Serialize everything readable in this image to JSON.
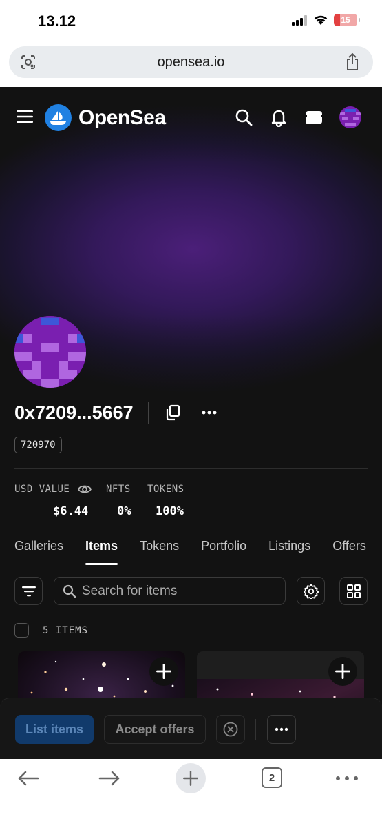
{
  "status_bar": {
    "time": "13.12",
    "battery": "15"
  },
  "browser": {
    "url": "opensea.io",
    "tab_count": "2"
  },
  "header": {
    "brand": "OpenSea"
  },
  "profile": {
    "address": "0x7209...5667",
    "id": "720970",
    "stats": {
      "labels": [
        "USD VALUE",
        "NFTS",
        "TOKENS"
      ],
      "values": [
        "$6.44",
        "0%",
        "100%"
      ]
    }
  },
  "tabs": [
    "Galleries",
    "Items",
    "Tokens",
    "Portfolio",
    "Listings",
    "Offers"
  ],
  "active_tab": "Items",
  "search": {
    "placeholder": "Search for items"
  },
  "items": {
    "count_label": "5 ITEMS"
  },
  "actions": {
    "list_label": "List items",
    "accept_label": "Accept offers"
  },
  "colors": {
    "accent": "#2081e2",
    "purple": "#4b1f79",
    "avatar": "#7a1fb0"
  },
  "icons": [
    "menu-icon",
    "search-icon",
    "bell-icon",
    "wallet-icon",
    "copy-icon",
    "more-icon",
    "eye-icon",
    "filter-icon",
    "settings-icon",
    "grid-icon",
    "plus-icon",
    "cancel-icon",
    "back-icon",
    "forward-icon",
    "share-icon"
  ]
}
